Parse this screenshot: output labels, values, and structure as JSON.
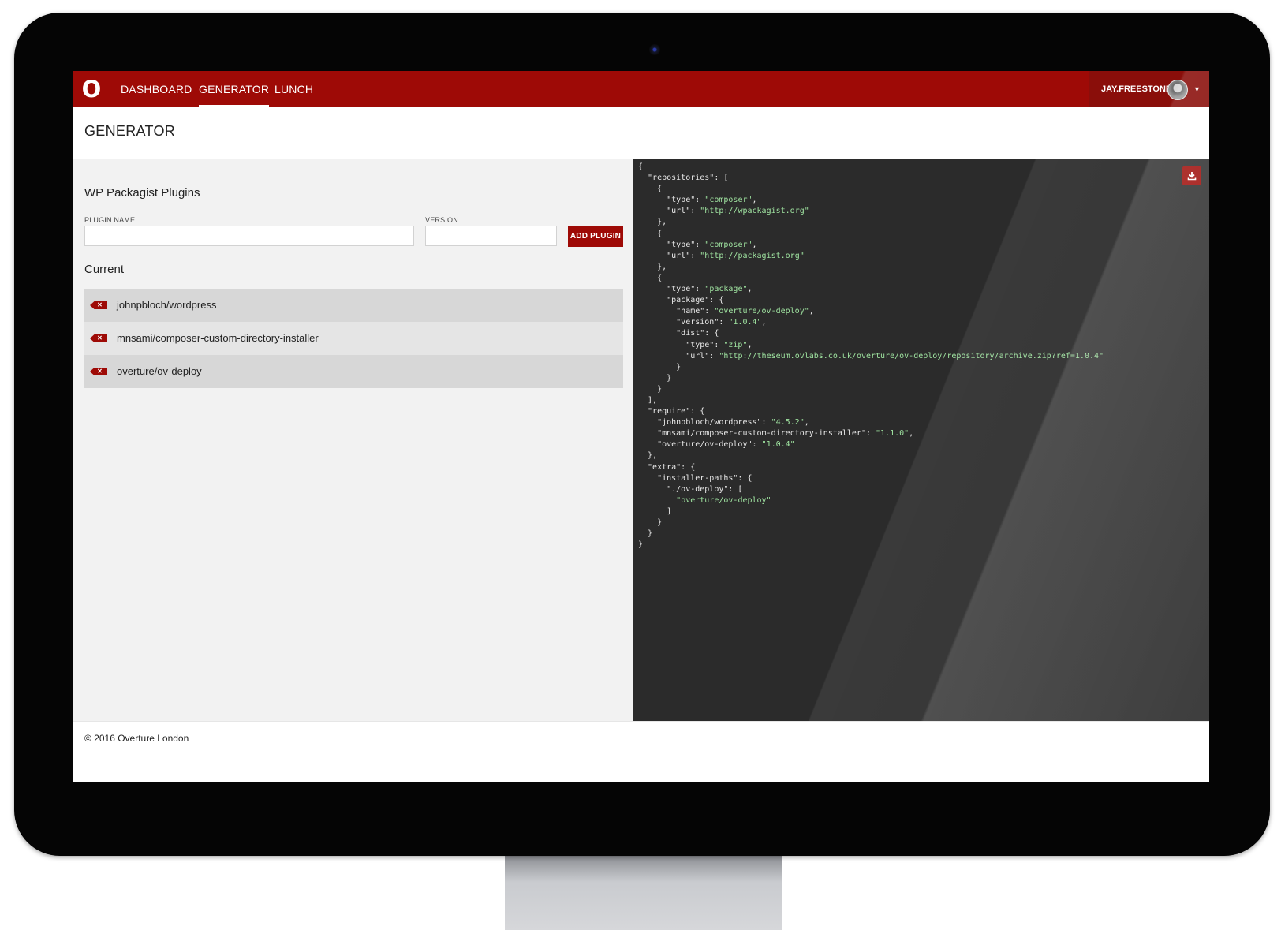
{
  "nav": {
    "logo": "O",
    "items": [
      {
        "label": "DASHBOARD"
      },
      {
        "label": "GENERATOR"
      },
      {
        "label": "LUNCH"
      }
    ],
    "active": "GENERATOR",
    "user": {
      "name": "JAY.FREESTONE",
      "caret": "▼"
    }
  },
  "page": {
    "title": "GENERATOR"
  },
  "form": {
    "section_title": "WP Packagist Plugins",
    "plugin_name_label": "PLUGIN NAME",
    "plugin_name_value": "",
    "version_label": "VERSION",
    "version_value": "",
    "add_button_label": "ADD PLUGIN"
  },
  "current": {
    "title": "Current",
    "items": [
      {
        "name": "johnpbloch/wordpress"
      },
      {
        "name": "mnsami/composer-custom-directory-installer"
      },
      {
        "name": "overture/ov-deploy"
      }
    ]
  },
  "composer_json": {
    "repositories": [
      {
        "type": "composer",
        "url": "http://wpackagist.org"
      },
      {
        "type": "composer",
        "url": "http://packagist.org"
      },
      {
        "type": "package",
        "package": {
          "name": "overture/ov-deploy",
          "version": "1.0.4",
          "dist": {
            "type": "zip",
            "url": "http://theseum.ovlabs.co.uk/overture/ov-deploy/repository/archive.zip?ref=1.0.4"
          }
        }
      }
    ],
    "require": {
      "johnpbloch/wordpress": "4.5.2",
      "mnsami/composer-custom-directory-installer": "1.1.0",
      "overture/ov-deploy": "1.0.4"
    },
    "extra": {
      "installer-paths": {
        "./ov-deploy": [
          "overture/ov-deploy"
        ]
      }
    }
  },
  "footer": {
    "text": "© 2016 Overture London"
  },
  "colors": {
    "brand_red": "#9e0a06",
    "code_bg": "#2b2b2b",
    "code_string": "#9fe3a0"
  },
  "icons": {
    "remove": "remove-tag-icon",
    "download": "download-icon"
  }
}
